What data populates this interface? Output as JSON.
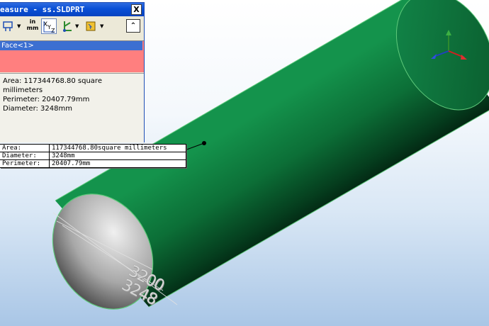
{
  "dialog": {
    "title": "easure - ss.SLDPRT",
    "close_label": "X",
    "units_label_top": "in",
    "units_label_bottom": "mm",
    "collapse_label": "⌃",
    "selection": "Face<1>",
    "results": {
      "area": "Area: 117344768.80 square millimeters",
      "perimeter": "Perimeter: 20407.79mm",
      "diameter": "Diameter: 3248mm"
    }
  },
  "callout": {
    "rows": [
      {
        "key": "Area:",
        "value": "117344768.80square millimeters"
      },
      {
        "key": "Diameter:",
        "value": "3248mm"
      },
      {
        "key": "Perimeter:",
        "value": "20407.79mm"
      }
    ]
  },
  "dimension_text": {
    "line1": "3200",
    "line2": "3248"
  },
  "colors": {
    "cylinder_green": "#0e7a3f",
    "cylinder_highlight": "#5ec97a",
    "face_highlight": "#ff7f7f",
    "titlebar_blue": "#0a4fd6"
  },
  "icons": [
    "measure-dropdown-icon",
    "xyz-coordinate-icon",
    "point-to-point-icon",
    "face-select-icon",
    "triad-icon"
  ]
}
